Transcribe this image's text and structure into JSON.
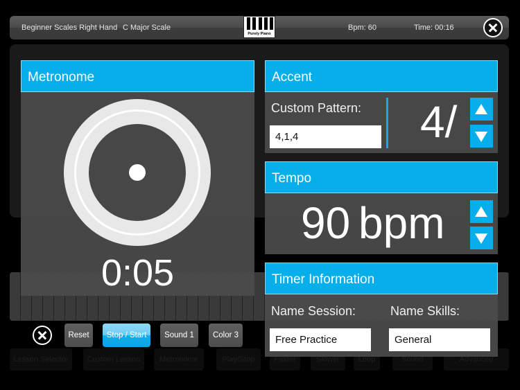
{
  "topbar": {
    "lesson": "Beginner Scales Right Hand",
    "scale": "C Major Scale",
    "logo_text": "Purely Piano",
    "bpm_label": "Bpm: 60",
    "time_label": "Time: 00:16",
    "close_icon": "close-circle-icon"
  },
  "background_app": {
    "bottom_buttons": [
      "Lesson Selector",
      "Custom Lesson",
      "Metronome",
      "Play/Stop",
      "Faster",
      "Slower",
      "Loop",
      "Sound",
      "Advanced"
    ]
  },
  "metronome": {
    "title": "Metronome",
    "elapsed": "0:05"
  },
  "accent": {
    "title": "Accent",
    "custom_pattern_label": "Custom Pattern:",
    "custom_pattern_value": "4,1,4",
    "beats_value": "4/"
  },
  "tempo": {
    "title": "Tempo",
    "value": "90",
    "unit": "bpm"
  },
  "timer_info": {
    "title": "Timer Information",
    "session_label": "Name Session:",
    "session_value": "Free Practice",
    "skills_label": "Name Skills:",
    "skills_value": "General"
  },
  "controls": {
    "reset": "Reset",
    "stop_start": "Stop / Start",
    "sound": "Sound 1",
    "color": "Color 3"
  },
  "colors": {
    "accent_blue": "#06aeea",
    "panel_gray": "#4b4b4b"
  }
}
